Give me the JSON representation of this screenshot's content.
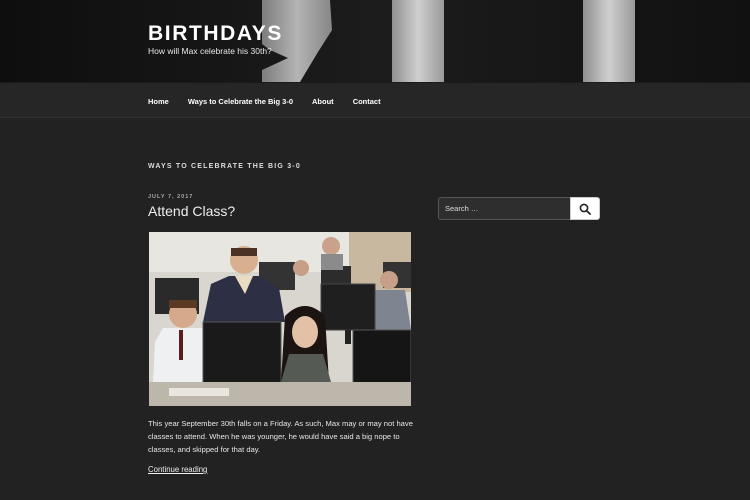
{
  "header": {
    "title": "BIRTHDAYS",
    "tagline": "How will Max celebrate his 30th?"
  },
  "nav": {
    "items": [
      "Home",
      "Ways to Celebrate the Big 3-0",
      "About",
      "Contact"
    ]
  },
  "page": {
    "archive_title": "WAYS TO CELEBRATE THE BIG 3-0"
  },
  "post": {
    "date": "JULY 7, 2017",
    "title": "Attend Class?",
    "image_icon": "classroom-photo",
    "excerpt": "This year September 30th falls on a Friday. As such, Max may or may not have classes to attend. When he was younger, he would have said a big nope to classes, and skipped for that day.",
    "read_more": "Continue reading"
  },
  "search": {
    "placeholder": "Search …",
    "button_icon": "search-icon"
  }
}
